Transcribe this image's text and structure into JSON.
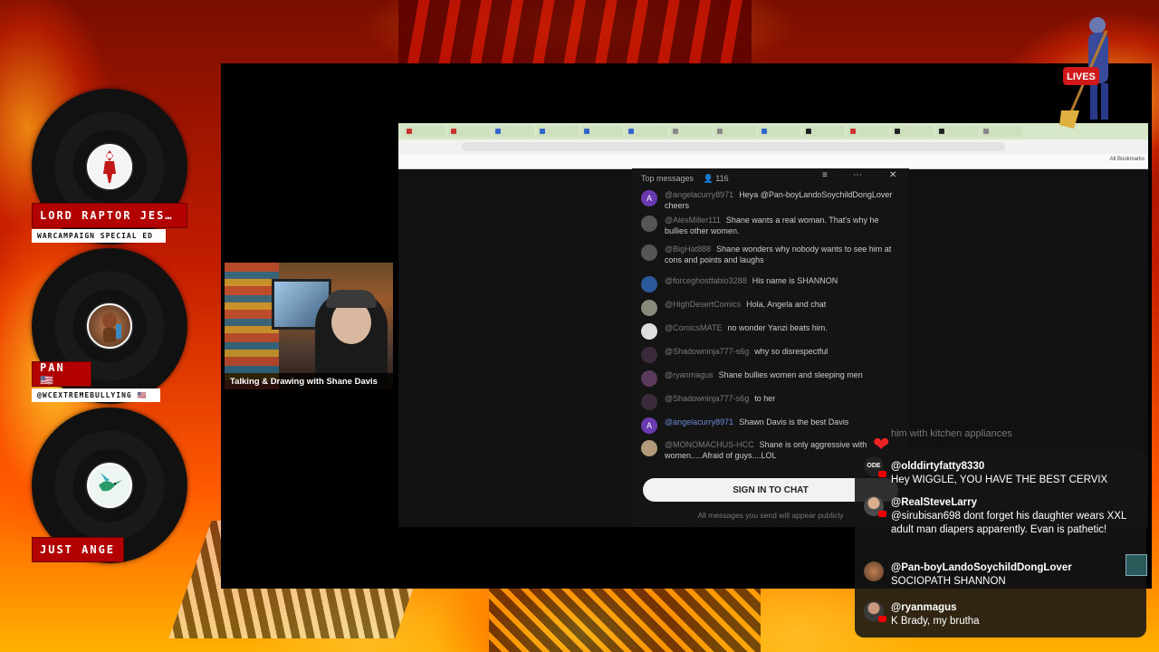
{
  "participants": [
    {
      "name": "LORD RAPTOR JES…",
      "subtitle": "WARCAMPAIGN SPECIAL ED",
      "avatar_icon": "red-wrestler-avatar-icon"
    },
    {
      "name": "PAN 🇺🇸",
      "subtitle": "@WCEXTREMEBULLYING 🇺🇸",
      "avatar_icon": "figurine-avatar-icon"
    },
    {
      "name": "JUST ANGE",
      "subtitle": "",
      "avatar_icon": "hummingbird-avatar-icon"
    }
  ],
  "webcam": {
    "caption": "Talking & Drawing with Shane Davis"
  },
  "yt_chat": {
    "header": "Top messages",
    "viewer_count": "116",
    "messages": [
      {
        "user": "@angelacurry8971",
        "text": "Heya @Pan-boyLandoSoychildDongLover cheers",
        "avatar": ""
      },
      {
        "user": "@AlexMiller111",
        "text": "Shane wants a real woman. That's why he bullies other women.",
        "avatar": ""
      },
      {
        "user": "@BigHat888",
        "text": "Shane wonders why nobody wants to see him at cons and points and laughs",
        "avatar": ""
      },
      {
        "user": "@forceghostfabio3288",
        "text": "His name is SHANNON",
        "avatar": ""
      },
      {
        "user": "@HighDesertComics",
        "text": "Hola, Angela and chat",
        "avatar": ""
      },
      {
        "user": "@ComicsMATE",
        "text": "no wonder Yanzi beats him.",
        "avatar": ""
      },
      {
        "user": "@Shadowninja777-s6g",
        "text": "why so disrespectful",
        "avatar": ""
      },
      {
        "user": "@ryanmagus",
        "text": "Shane bullies women and sleeping men",
        "avatar": ""
      },
      {
        "user": "@Shadowninja777-s6g",
        "text": "to her",
        "avatar": ""
      },
      {
        "user": "@angelacurry8971",
        "text": "Shawn Davis is the best Davis",
        "avatar": "A"
      },
      {
        "user": "@MONOMACHUS-HCC",
        "text": "Shane is only aggressive with women.....Afraid of guys....LOL",
        "avatar": ""
      }
    ],
    "sign_in_label": "SIGN IN TO CHAT",
    "public_note": "All messages you send will appear publicly"
  },
  "overlay_chat": {
    "fading_text": "him with kitchen appliances",
    "messages": [
      {
        "user": "@olddirtyfatty8330",
        "text": "Hey WIGGLE, YOU HAVE THE BEST CERVIX",
        "avatar_icon": "ode-avatar-icon"
      },
      {
        "user": "@RealSteveLarry",
        "text": "@sirubisan698 dont forget his daughter wears XXL adult man diapers apparently. Evan is pathetic!",
        "avatar_icon": "person-avatar-icon"
      },
      {
        "user": "@Pan-boyLandoSoychildDongLover",
        "text": "SOCIOPATH SHANNON",
        "avatar_icon": "person-avatar-icon"
      },
      {
        "user": "@ryanmagus",
        "text": "K Brady, my brutha",
        "avatar_icon": "person-avatar-icon"
      }
    ]
  },
  "browser": {
    "bookmarks_label": "All Bookmarks",
    "logo_text": "LIVES"
  },
  "colors": {
    "tag_red": "#b30000",
    "overlay_bg": "#141414",
    "tab_bar": "#d7e8c9"
  }
}
